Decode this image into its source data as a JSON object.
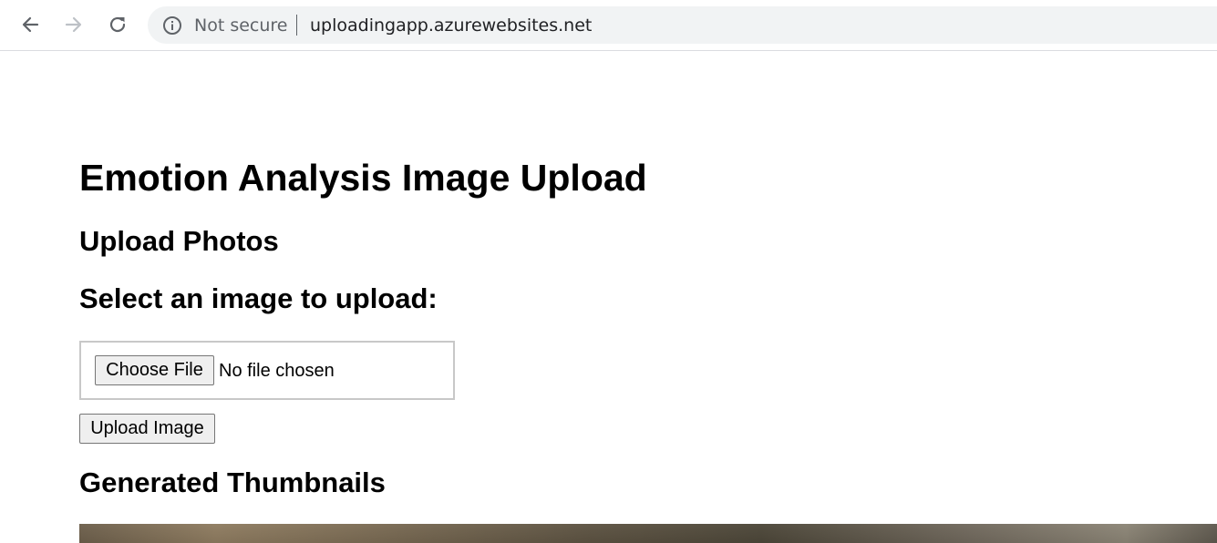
{
  "browser": {
    "back_icon": "arrow-left-icon",
    "forward_icon": "arrow-right-icon",
    "reload_icon": "reload-icon",
    "info_icon": "info-circle-icon",
    "security_label": "Not secure",
    "url": "uploadingapp.azurewebsites.net"
  },
  "page": {
    "title": "Emotion Analysis Image Upload",
    "upload_heading": "Upload Photos",
    "select_heading": "Select an image to upload:",
    "file_input": {
      "button_label": "Choose File",
      "status": "No file chosen"
    },
    "upload_button_label": "Upload Image",
    "thumbnails_heading": "Generated Thumbnails"
  }
}
